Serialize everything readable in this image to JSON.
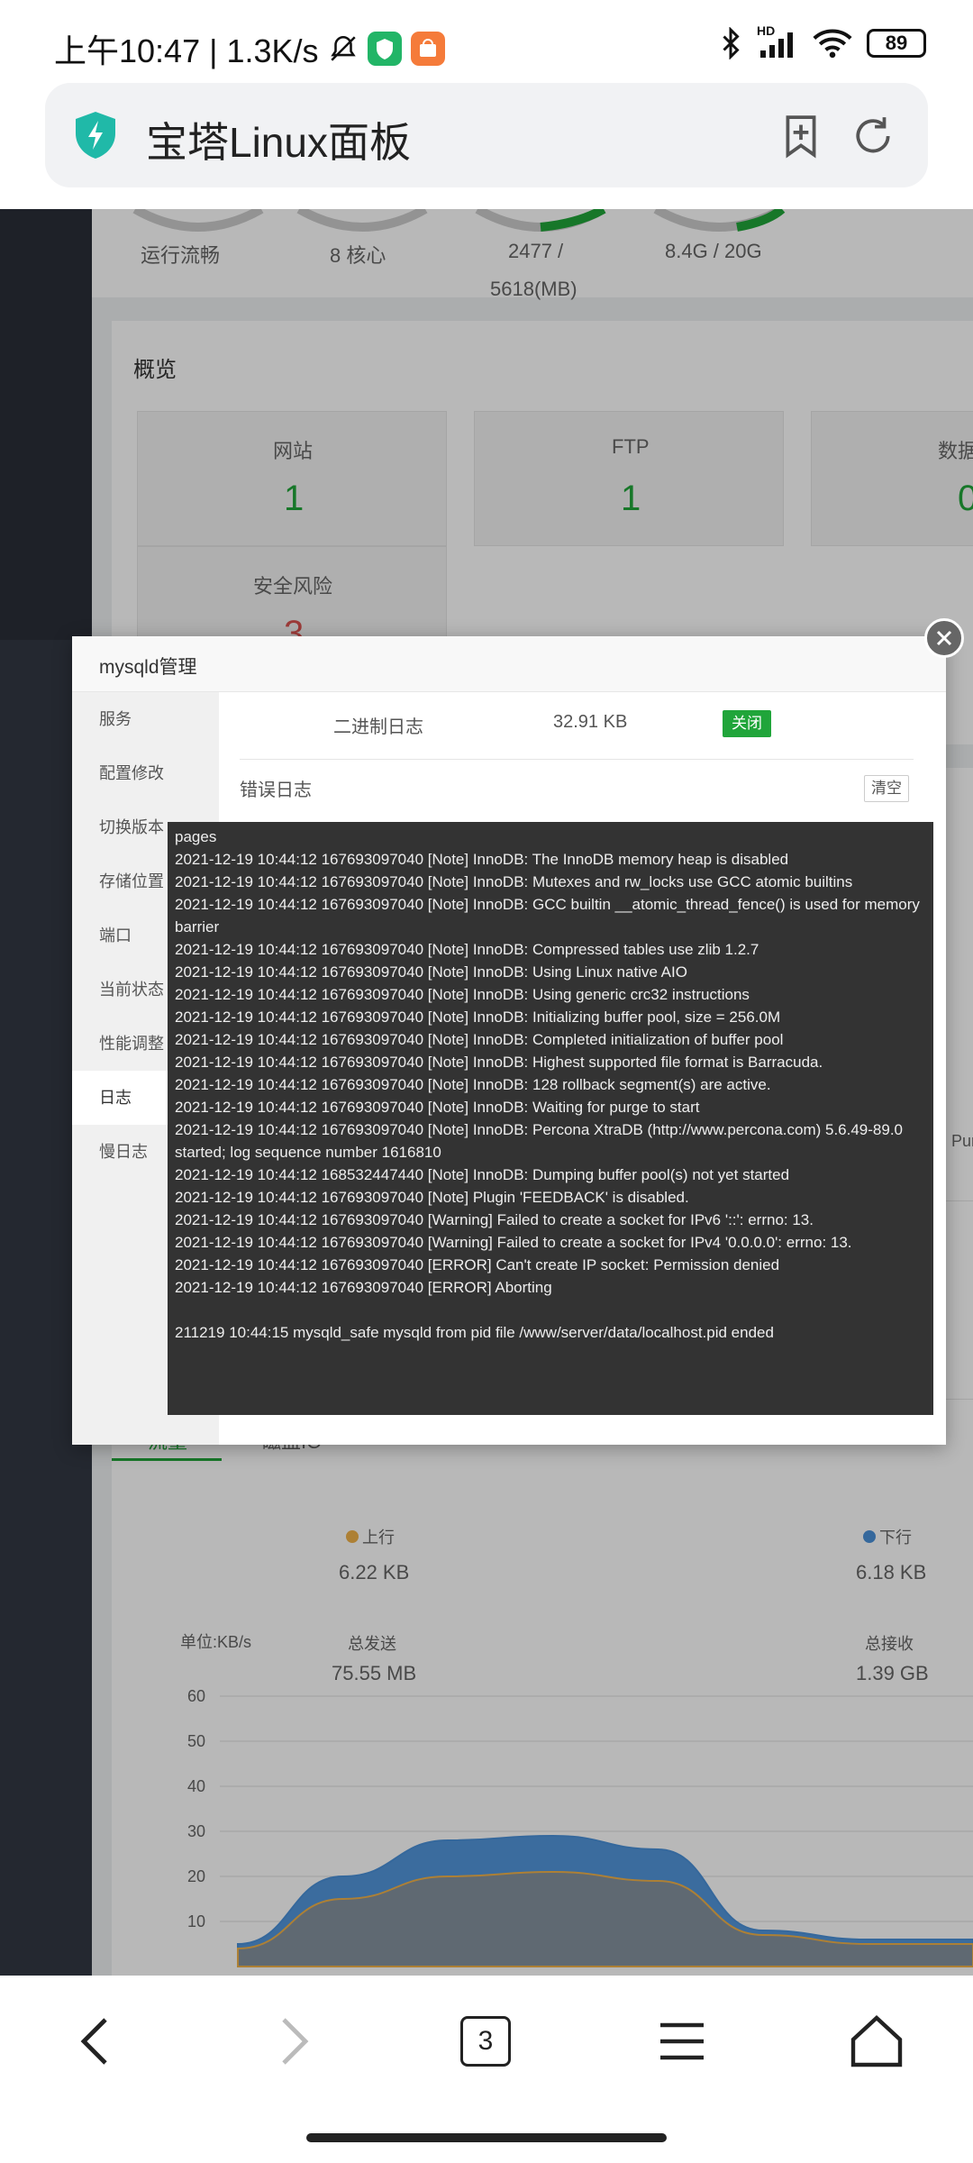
{
  "status_bar": {
    "time_text": "上午10:47 | 1.3K/s",
    "battery": "89",
    "hd": "HD"
  },
  "browser": {
    "page_title": "宝塔Linux面板",
    "tab_count": "3"
  },
  "dashboard": {
    "gauges": [
      "运行流畅",
      "8 核心",
      "2477 /",
      "5618(MB)",
      "8.4G / 20G"
    ],
    "overview_title": "概览",
    "stats": [
      {
        "label": "网站",
        "value": "1"
      },
      {
        "label": "FTP",
        "value": "1"
      },
      {
        "label": "数据",
        "value": "0"
      },
      {
        "label": "安全风险",
        "value": "3"
      }
    ],
    "right_partial": "Pur",
    "traffic_tabs": [
      "流量",
      "磁盘IO"
    ],
    "up_label": "上行",
    "up_value": "6.22 KB",
    "down_label": "下行",
    "down_value": "6.18 KB",
    "unit_label": "单位:KB/s",
    "total_send_label": "总发送",
    "total_send_value": "75.55 MB",
    "total_recv_label": "总接收",
    "total_recv_value": "1.39 GB",
    "y_ticks": [
      "60",
      "50",
      "40",
      "30",
      "20",
      "10"
    ]
  },
  "chart_data": {
    "type": "area",
    "title": "",
    "ylabel": "单位:KB/s",
    "ylim": [
      0,
      60
    ],
    "y_ticks": [
      10,
      20,
      30,
      40,
      50,
      60
    ],
    "series": [
      {
        "name": "上行",
        "color": "#4a90d9",
        "values": [
          5,
          20,
          28,
          29,
          26,
          8,
          6,
          6
        ]
      },
      {
        "name": "下行",
        "color": "#f0b24a",
        "values": [
          4,
          15,
          20,
          21,
          19,
          7,
          5,
          5
        ]
      }
    ]
  },
  "modal": {
    "title": "mysqld管理",
    "menu": [
      "服务",
      "配置修改",
      "切换版本",
      "存储位置",
      "端口",
      "当前状态",
      "性能调整",
      "日志",
      "慢日志"
    ],
    "active_menu": "日志",
    "binlog_label": "二进制日志",
    "binlog_size": "32.91 KB",
    "binlog_button": "关闭",
    "error_log_label": "错误日志",
    "clear_button": "清空",
    "log_lines": [
      "pages",
      "2021-12-19 10:44:12 167693097040 [Note] InnoDB: The InnoDB memory heap is disabled",
      "2021-12-19 10:44:12 167693097040 [Note] InnoDB: Mutexes and rw_locks use GCC atomic builtins",
      "2021-12-19 10:44:12 167693097040 [Note] InnoDB: GCC builtin __atomic_thread_fence() is used for memory barrier",
      "2021-12-19 10:44:12 167693097040 [Note] InnoDB: Compressed tables use zlib 1.2.7",
      "2021-12-19 10:44:12 167693097040 [Note] InnoDB: Using Linux native AIO",
      "2021-12-19 10:44:12 167693097040 [Note] InnoDB: Using generic crc32 instructions",
      "2021-12-19 10:44:12 167693097040 [Note] InnoDB: Initializing buffer pool, size = 256.0M",
      "2021-12-19 10:44:12 167693097040 [Note] InnoDB: Completed initialization of buffer pool",
      "2021-12-19 10:44:12 167693097040 [Note] InnoDB: Highest supported file format is Barracuda.",
      "2021-12-19 10:44:12 167693097040 [Note] InnoDB: 128 rollback segment(s) are active.",
      "2021-12-19 10:44:12 167693097040 [Note] InnoDB: Waiting for purge to start",
      "2021-12-19 10:44:12 167693097040 [Note] InnoDB:  Percona XtraDB (http://www.percona.com) 5.6.49-89.0 started; log sequence number 1616810",
      "2021-12-19 10:44:12 168532447440 [Note] InnoDB: Dumping buffer pool(s) not yet started",
      "2021-12-19 10:44:12 167693097040 [Note] Plugin 'FEEDBACK' is disabled.",
      "2021-12-19 10:44:12 167693097040 [Warning] Failed to create a socket for IPv6 '::': errno: 13.",
      "2021-12-19 10:44:12 167693097040 [Warning] Failed to create a socket for IPv4 '0.0.0.0': errno: 13.",
      "2021-12-19 10:44:12 167693097040 [ERROR] Can't create IP socket: Permission denied",
      "2021-12-19 10:44:12 167693097040 [ERROR] Aborting",
      "",
      "211219 10:44:15 mysqld_safe mysqld from pid file /www/server/data/localhost.pid ended"
    ]
  }
}
